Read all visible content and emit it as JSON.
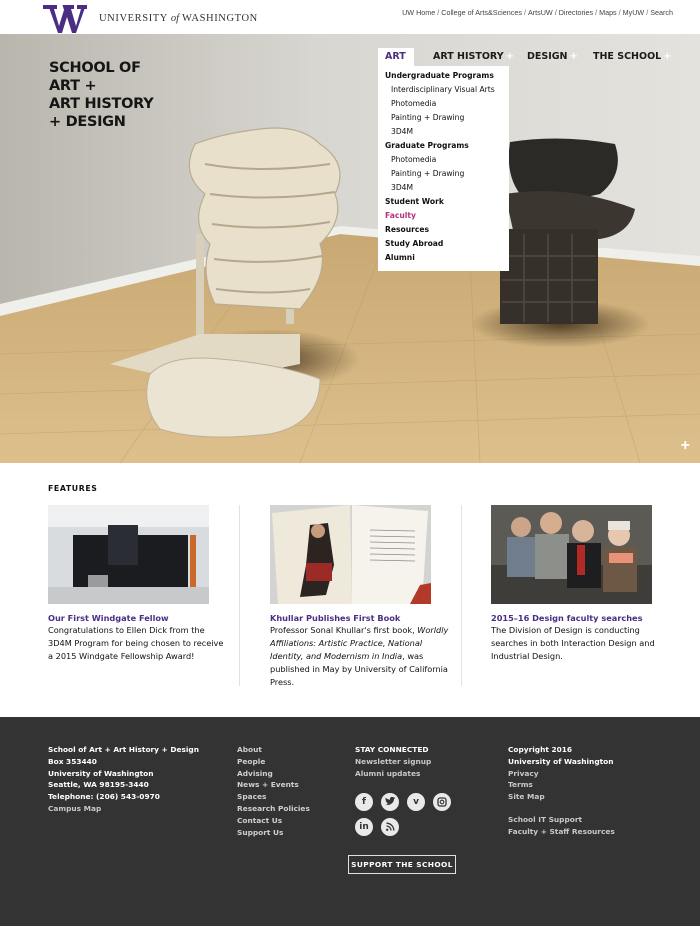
{
  "uw": {
    "wordmark_pre": "UNIVERSITY ",
    "wordmark_of": "of",
    "wordmark_post": " WASHINGTON",
    "top_links": [
      "UW Home",
      "College of Arts&Sciences",
      "ArtsUW",
      "Directories",
      "Maps",
      "MyUW",
      "Search"
    ],
    "separator": "/"
  },
  "school": {
    "title_lines": [
      "SCHOOL OF",
      "ART +",
      "ART HISTORY",
      "+ DESIGN"
    ]
  },
  "nav": {
    "items": [
      {
        "label": "ART",
        "plus": ""
      },
      {
        "label": "ART HISTORY",
        "plus": "+"
      },
      {
        "label": "DESIGN",
        "plus": "+"
      },
      {
        "label": "THE SCHOOL",
        "plus": "+"
      }
    ],
    "dropdown": [
      "Undergraduate Programs",
      "Interdisciplinary Visual Arts",
      "Photomedia",
      "Painting + Drawing",
      "3D4M",
      "Graduate Programs",
      "Photomedia",
      "Painting + Drawing",
      "3D4M",
      "Student Work",
      "Faculty",
      "Resources",
      "Study Abroad",
      "Alumni"
    ]
  },
  "hero": {
    "expand_symbol": "+"
  },
  "features": {
    "heading": "FEATURES",
    "items": [
      {
        "title": "Our First Windgate Fellow",
        "body": "Congratulations to Ellen Dick from the 3D4M Program for being chosen to receive a 2015 Windgate Fellowship Award!"
      },
      {
        "title": "Khullar Publishes First Book",
        "body_start": "Professor Sonal Khullar's first book, ",
        "body_italic": "Worldly Affiliations: Artistic Practice, National Identity, and Modernism in India",
        "body_end": ", was published in May by University of California Press."
      },
      {
        "title": "2015–16 Design faculty searches",
        "body": "The Division of Design is conducting searches in both Interaction Design and Industrial Design."
      }
    ]
  },
  "footer": {
    "address": [
      "School of Art + Art History + Design",
      "Box 353440",
      "University of Washington",
      "Seattle, WA 98195-3440",
      "Telephone: (206) 543-0970",
      "Campus Map"
    ],
    "links": [
      "About",
      "People",
      "Advising",
      "News + Events",
      "Spaces",
      "Research Policies",
      "Contact Us",
      "Support Us"
    ],
    "stay_connected": {
      "heading": "STAY CONNECTED",
      "links": [
        "Newsletter signup",
        "Alumni updates"
      ]
    },
    "social_icons": [
      "facebook-icon",
      "twitter-icon",
      "vimeo-icon",
      "instagram-icon",
      "linkedin-icon",
      "rss-icon"
    ],
    "legal": [
      "Copyright 2016",
      "University of Washington",
      "Privacy",
      "Terms",
      "Site Map"
    ],
    "resources": [
      "School IT Support",
      "Faculty + Staff Resources"
    ],
    "support_button": "SUPPORT THE SCHOOL"
  },
  "colors": {
    "uw_purple": "#4b2e83",
    "active_link": "#b5307b",
    "footer_bg": "#333333"
  }
}
